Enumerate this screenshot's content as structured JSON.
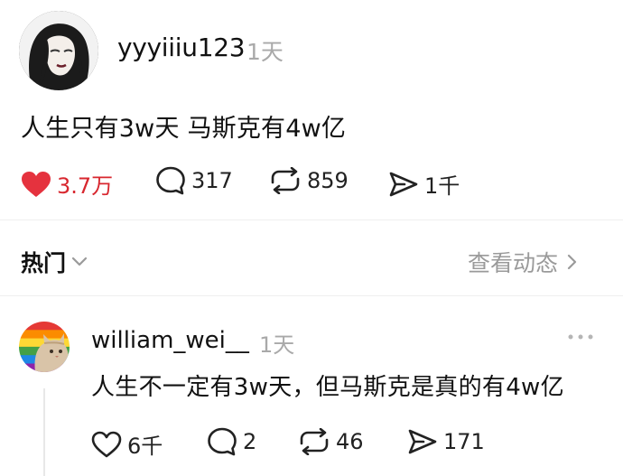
{
  "post": {
    "username": "yyyiiiu123",
    "time": "1天",
    "text": "人生只有3w天 马斯克有4w亿",
    "likes": "3.7万",
    "comments": "317",
    "reposts": "859",
    "shares": "1千",
    "like_color": "#e5323e"
  },
  "section": {
    "hot_label": "热门",
    "activity_label": "查看动态"
  },
  "comment": {
    "username": "william_wei__",
    "time": "1天",
    "text": "人生不一定有3w天，但马斯克是真的有4w亿",
    "likes": "6千",
    "replies": "2",
    "reposts": "46",
    "shares": "171"
  }
}
